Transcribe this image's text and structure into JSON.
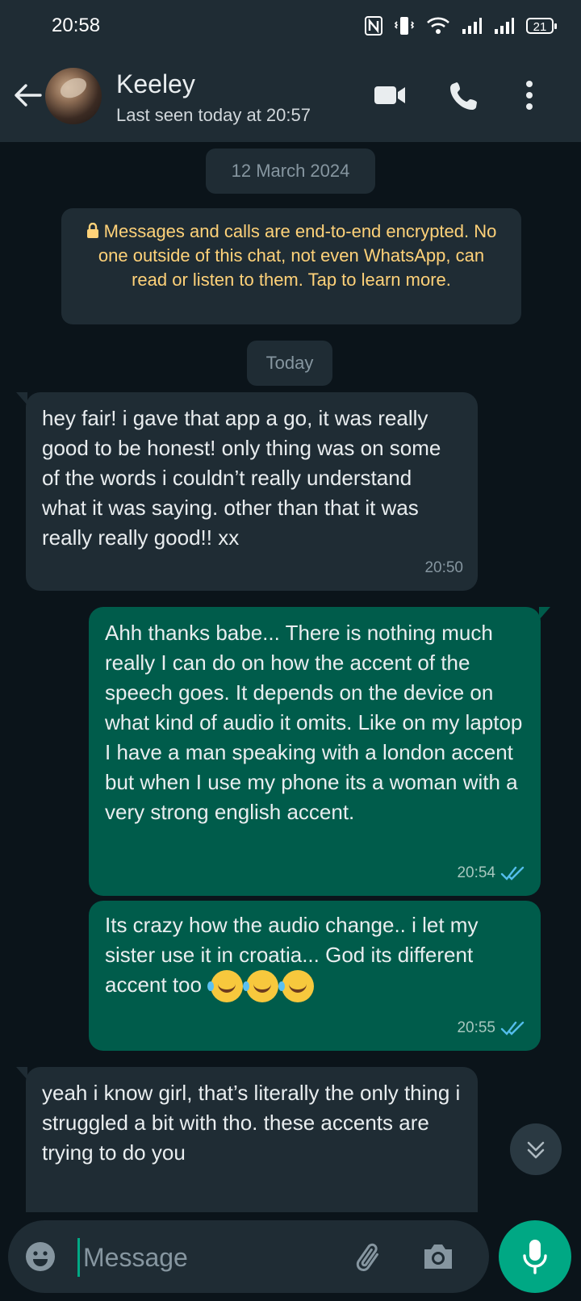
{
  "status_bar": {
    "time": "20:58",
    "battery": "21",
    "icons": [
      "nfc-icon",
      "vibrate-icon",
      "wifi-icon",
      "signal-icon",
      "signal-icon",
      "battery-icon"
    ]
  },
  "header": {
    "contact_name": "Keeley",
    "last_seen": "Last seen today at 20:57",
    "icons": [
      "back-arrow-icon",
      "video-call-icon",
      "voice-call-icon",
      "more-options-icon"
    ]
  },
  "chat": {
    "date_label": "12 March 2024",
    "encryption_notice": "Messages and calls are end-to-end encrypted. No one outside of this chat, not even WhatsApp, can read or listen to them. Tap to learn more.",
    "today_label": "Today",
    "messages": [
      {
        "direction": "incoming",
        "text": "hey fair! i gave that app a go, it was really good to be honest! only thing was on some of the words i couldn’t really understand what it was saying. other than that it was really really good!! xx",
        "time": "20:50"
      },
      {
        "direction": "outgoing",
        "text": "Ahh thanks babe... There is nothing much really I can do on how the accent of the speech goes. It depends on the device on what kind of audio it omits. Like on my laptop I have a man speaking with a london accent but when I use my phone its a woman with a very strong english accent.",
        "time": "20:54",
        "status": "read"
      },
      {
        "direction": "outgoing",
        "text": "Its crazy how the audio change.. i let my sister use it in croatia... God its different accent too",
        "emojis": [
          "rolling-on-floor-laughing",
          "rolling-on-floor-laughing",
          "rolling-on-floor-laughing"
        ],
        "time": "20:55",
        "status": "read"
      },
      {
        "direction": "incoming",
        "text": "yeah i know girl, that’s literally the only thing i struggled a bit with tho. these accents are trying to do you",
        "partial": true
      }
    ]
  },
  "composer": {
    "placeholder": "Message",
    "icons": [
      "emoji-icon",
      "attach-icon",
      "camera-icon",
      "mic-icon",
      "scroll-down-icon"
    ]
  },
  "colors": {
    "background": "#0b141a",
    "header": "#1f2c34",
    "incoming_bubble": "#1f2c34",
    "outgoing_bubble": "#005c4b",
    "accent": "#00a884",
    "encryption_text": "#ffd279",
    "read_ticks": "#53bdeb"
  }
}
